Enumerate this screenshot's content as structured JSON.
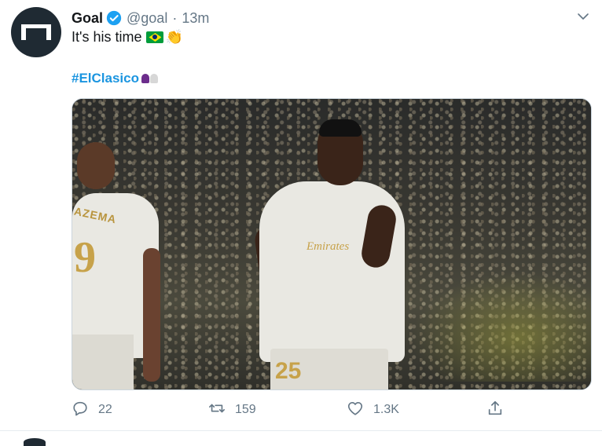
{
  "tweet": {
    "author_name": "Goal",
    "author_handle": "@goal",
    "separator": "·",
    "time": "13m",
    "text": "It's his time",
    "hashtag": "#ElClasico",
    "verified": true,
    "media_caption": {
      "player_left_name": "AZEMA",
      "player_left_number": "9",
      "sponsor": "Emirates",
      "player_right_number": "25"
    },
    "actions": {
      "reply_count": "22",
      "retweet_count": "159",
      "like_count": "1.3K"
    }
  },
  "colors": {
    "accent": "#1b95e0",
    "muted": "#657786",
    "avatar_bg": "#1f2a33",
    "verified": "#1da1f2"
  },
  "icons": [
    "goal-logo-icon",
    "verified-badge-icon",
    "chevron-down-icon",
    "brazil-flag-icon",
    "clapping-hands-icon",
    "clasico-emoji-icon",
    "reply-icon",
    "retweet-icon",
    "like-icon",
    "share-icon"
  ]
}
